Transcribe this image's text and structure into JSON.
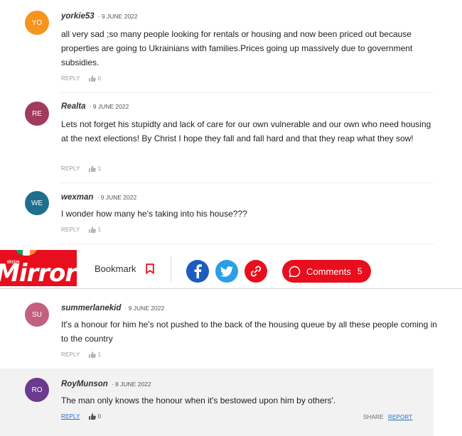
{
  "comments": [
    {
      "initials": "YO",
      "avatar_color": "#f7941d",
      "author": "yorkie53",
      "date": "· 9 JUNE 2022",
      "text": "all very sad ;so many people looking for rentals or housing and now been priced out because properties are going to Ukrainians with families.Prices going up massively due to government subsidies.",
      "reply": "REPLY",
      "likes": "0"
    },
    {
      "initials": "RE",
      "avatar_color": "#a23a5c",
      "author": "Realta",
      "date": "· 9 JUNE 2022",
      "text": "Lets not forget his stupidty and lack of care for our own vulnerable and our own who need housing at the next elections! By Christ I hope they fall and fall hard and that they reap what they sow!",
      "reply": "REPLY",
      "likes": "1"
    },
    {
      "initials": "WE",
      "avatar_color": "#1f6e8c",
      "author": "wexman",
      "date": "· 9 JUNE 2022",
      "text": "I wonder how many he's taking into his house???",
      "reply": "REPLY",
      "likes": "1"
    },
    {
      "initials": "SU",
      "avatar_color": "#c2607e",
      "author": "summerlanekid",
      "date": "· 9 JUNE 2022",
      "text": "It's a honour for him he's not pushed to the back of the housing queue by all these people coming in to the country",
      "reply": "REPLY",
      "likes": "1"
    },
    {
      "initials": "RO",
      "avatar_color": "#6b3a8e",
      "author": "RoyMunson",
      "date": "· 8 JUNE 2022",
      "text": "The man only knows the honour when it's bestowed upon him by others'.",
      "reply": "REPLY",
      "likes": "0",
      "share": "SHARE",
      "report": "REPORT"
    }
  ],
  "toolbar": {
    "logo_small": "IRISH",
    "logo_text": "Mirror",
    "bookmark_label": "Bookmark",
    "comments_label": "Comments",
    "comments_count": "5",
    "brand_color": "#e90e1d",
    "facebook_color": "#1d5bbf",
    "twitter_color": "#2a9fe6",
    "link_color": "#e90e1d",
    "icons": [
      "bookmark-icon",
      "facebook-icon",
      "twitter-icon",
      "link-icon",
      "comment-bubble-icon"
    ]
  }
}
